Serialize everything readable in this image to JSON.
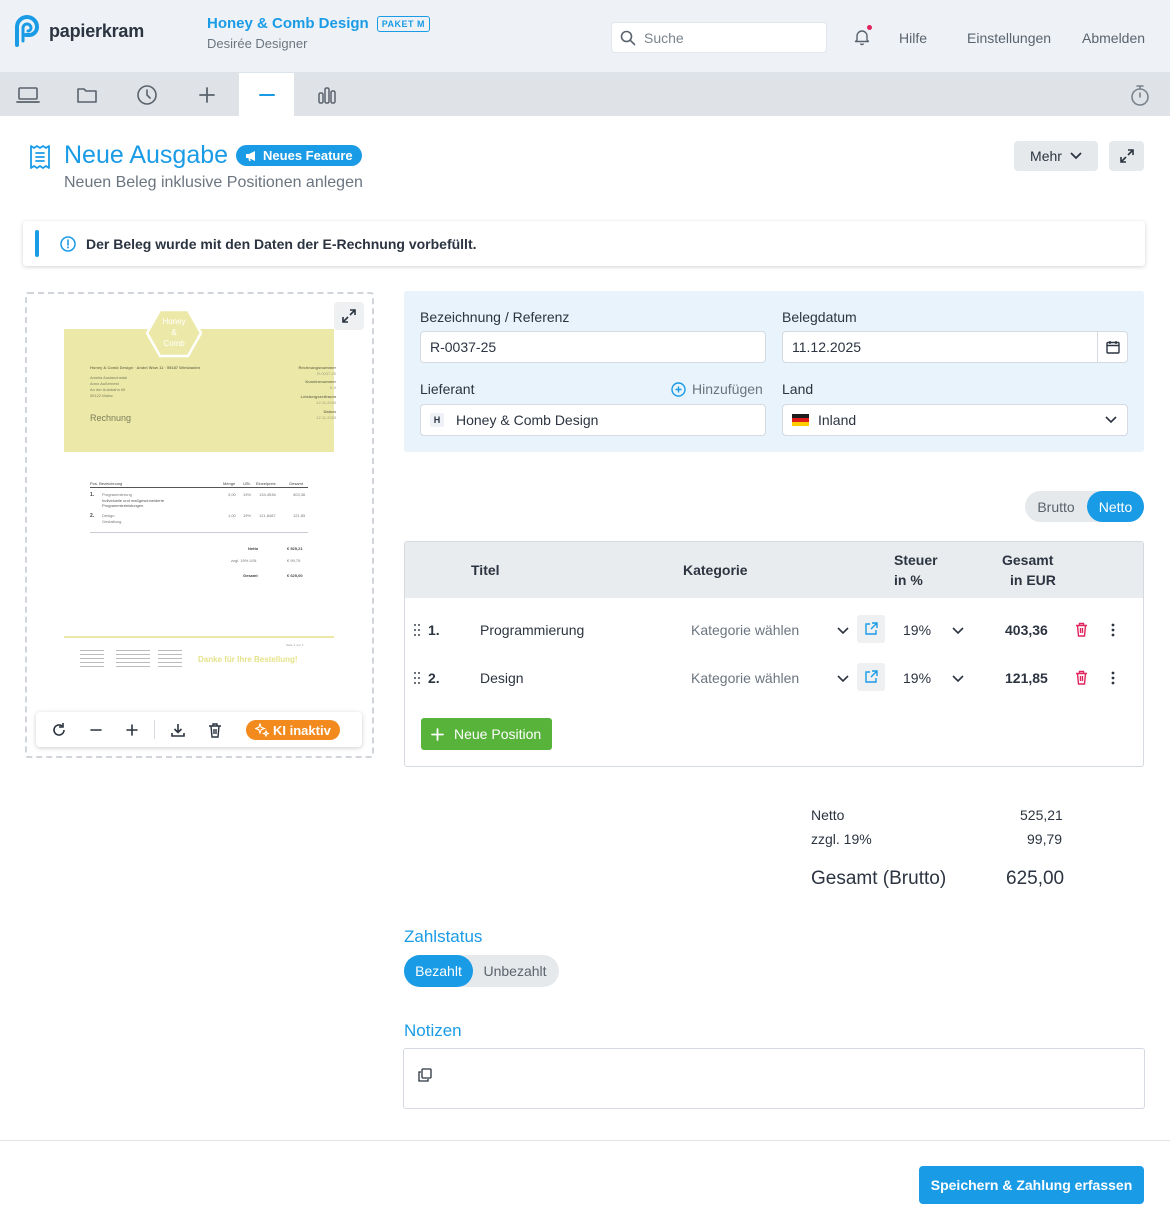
{
  "app": {
    "logo_text": "papierkram"
  },
  "company": {
    "name": "Honey & Comb Design",
    "plan_badge": "PAKET M",
    "user": "Desirée Designer"
  },
  "search": {
    "placeholder": "Suche"
  },
  "nav": {
    "help": "Hilfe",
    "settings": "Einstellungen",
    "logout": "Abmelden"
  },
  "tabs": [
    {
      "icon": "laptop-icon"
    },
    {
      "icon": "folder-icon"
    },
    {
      "icon": "clock-icon"
    },
    {
      "icon": "plus-icon"
    },
    {
      "icon": "minus-icon",
      "active": true
    },
    {
      "icon": "bar-chart-icon"
    }
  ],
  "page": {
    "title": "Neue Ausgabe",
    "feature_badge": "Neues Feature",
    "subtitle": "Neuen Beleg inklusive Positionen anlegen",
    "more_label": "Mehr"
  },
  "alert": {
    "text": "Der Beleg wurde mit den Daten der E-Rechnung vorbefüllt."
  },
  "preview_doc": {
    "logo_line1": "Honey",
    "logo_line2": "&",
    "logo_line3": "Comb",
    "sender": "Honey & Comb Design · Andel Wow 11 · 55187 Wiesbaden",
    "recipient": [
      "Amelia Auslauchstab",
      "Anno Außernest",
      "An der Autobahn 65",
      "55122 Mainz"
    ],
    "doc_title": "Rechnung",
    "meta": [
      "Rechnungsnummer",
      "R-0037-25",
      "Kundennummer",
      "K-9",
      "Leistungszeitraum",
      "12.11.2025",
      "Datum",
      "12.11.2025"
    ],
    "table_head": [
      "Pos. Bezeichnung",
      "Menge",
      "USt.",
      "Einzelpreis",
      "Gesamt"
    ],
    "items": [
      {
        "pos": "1.",
        "title": "Programmierung",
        "desc": "Individuelle und maßgeschneiderte Programmierleistungen",
        "qty": "3,00",
        "vat": "19%",
        "price": "134,4536",
        "total": "403,36"
      },
      {
        "pos": "2.",
        "title": "Design",
        "desc": "Gestaltung",
        "qty": "1,00",
        "vat": "19%",
        "price": "121,8487",
        "total": "121,85"
      }
    ],
    "totals": [
      [
        "Netto",
        "€ 525,21"
      ],
      [
        "zzgl. 19% USt.",
        "€ 99,79"
      ],
      [
        "Gesamt",
        "€ 625,00"
      ]
    ],
    "thanks": "Danke für Ihre Bestellung!",
    "page_no": "Seite 1 von 1"
  },
  "preview_tools": {
    "ki_label": "KI inaktiv"
  },
  "form": {
    "ref_label": "Bezeichnung / Referenz",
    "ref_value": "R-0037-25",
    "date_label": "Belegdatum",
    "date_value": "11.12.2025",
    "supplier_label": "Lieferant",
    "supplier_add": "Hinzufügen",
    "supplier_initial": "H",
    "supplier_value": "Honey & Comb Design",
    "country_label": "Land",
    "country_value": "Inland"
  },
  "mode_toggle": {
    "brutto": "Brutto",
    "netto": "Netto",
    "selected": "Netto"
  },
  "positions": {
    "col_title": "Titel",
    "col_category": "Kategorie",
    "col_tax_1": "Steuer",
    "col_tax_2": "in %",
    "col_total_1": "Gesamt",
    "col_total_2": "in EUR",
    "rows": [
      {
        "num": "1.",
        "title": "Programmierung",
        "category": "Kategorie wählen",
        "tax": "19%",
        "total": "403,36"
      },
      {
        "num": "2.",
        "title": "Design",
        "category": "Kategorie wählen",
        "tax": "19%",
        "total": "121,85"
      }
    ],
    "new_button": "Neue Position"
  },
  "summary": {
    "net_label": "Netto",
    "net_value": "525,21",
    "vat_label": "zzgl. 19%",
    "vat_value": "99,79",
    "gross_label": "Gesamt (Brutto)",
    "gross_value": "625,00"
  },
  "payment": {
    "heading": "Zahlstatus",
    "paid": "Bezahlt",
    "unpaid": "Unbezahlt",
    "selected": "Bezahlt"
  },
  "notes": {
    "heading": "Notizen"
  },
  "footer": {
    "save_button": "Speichern & Zahlung erfassen"
  },
  "colors": {
    "accent": "#1a9be6",
    "green": "#57b33a",
    "orange": "#f28a1e",
    "danger": "#e0245e"
  }
}
